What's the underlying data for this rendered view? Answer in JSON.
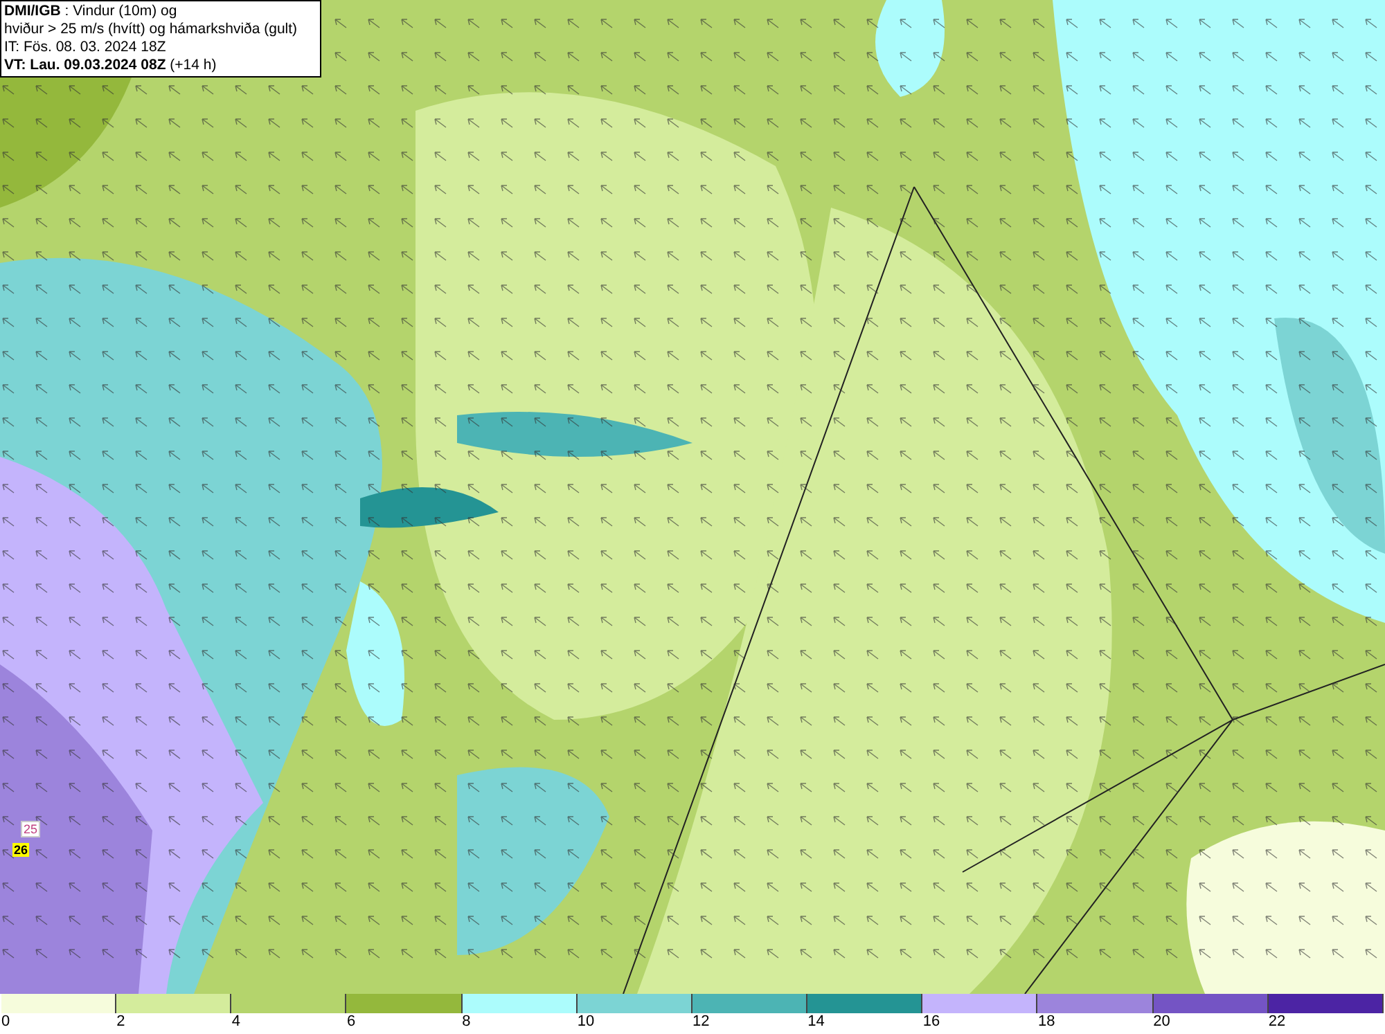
{
  "info_box": {
    "lines": [
      "**DMI/IGB** : Vindur (10m) og",
      "hviður > 25 m/s (hvítt) og hámarkshviða (gult)",
      "IT: Fös. 08. 03. 2024 18Z",
      "**VT: Lau. 09.03.2024 08Z** (+14 h)"
    ]
  },
  "map": {
    "labels": [
      {
        "text": "25",
        "kind": "gust"
      },
      {
        "text": "26",
        "kind": "max_gust"
      }
    ]
  },
  "legend": {
    "stops": [
      {
        "label": "0",
        "color": "#f6fcdc"
      },
      {
        "label": "2",
        "color": "#d4ec9c"
      },
      {
        "label": "4",
        "color": "#b4d46c"
      },
      {
        "label": "6",
        "color": "#94b83c"
      },
      {
        "label": "8",
        "color": "#acfcfc"
      },
      {
        "label": "10",
        "color": "#7cd4d4"
      },
      {
        "label": "12",
        "color": "#4cb4b4"
      },
      {
        "label": "14",
        "color": "#249494"
      },
      {
        "label": "16",
        "color": "#c4b4fc"
      },
      {
        "label": "18",
        "color": "#9c84dc"
      },
      {
        "label": "20",
        "color": "#7454c4"
      },
      {
        "label": "22",
        "color": "#4c24a4"
      }
    ]
  }
}
